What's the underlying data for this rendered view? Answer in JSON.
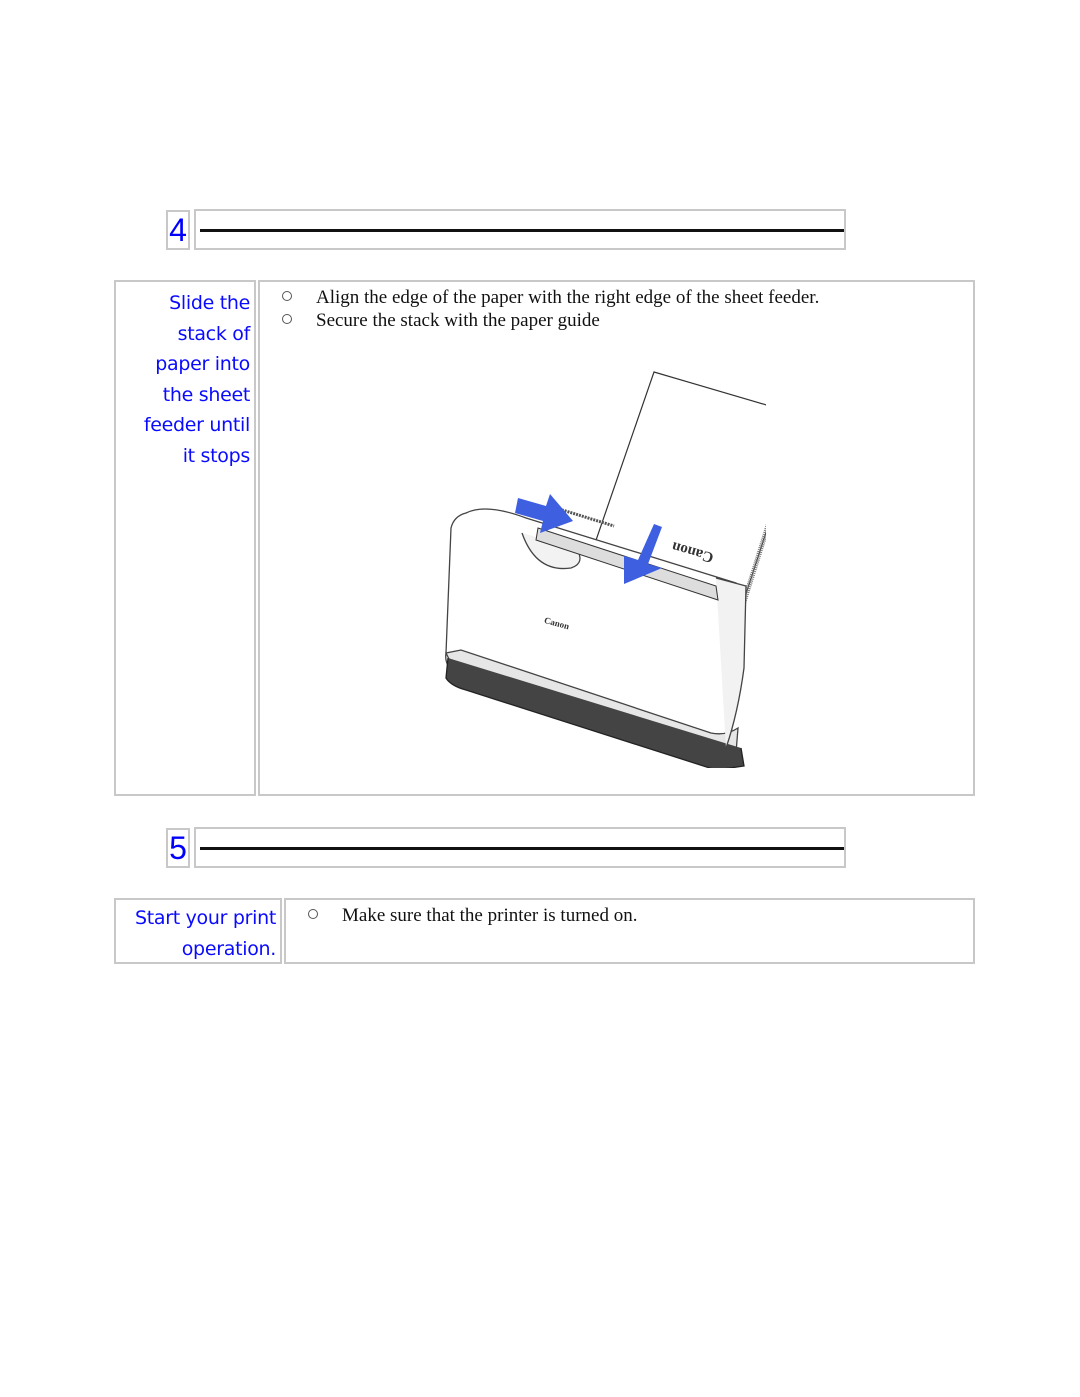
{
  "steps": [
    {
      "number": "4",
      "instruction": [
        "Slide the",
        "stack of",
        "paper into",
        "the sheet",
        "feeder until",
        "it stops"
      ],
      "bullets": [
        "Align the edge of the paper with the right edge of the sheet feeder.",
        "Secure the stack with the paper guide"
      ],
      "illustration": {
        "description": "Canon printer with paper stack loaded in sheet feeder; blue arrows indicate pushing paper guide and sliding paper down",
        "brand_label_front": "Canon",
        "brand_label_paper": "Canon",
        "arrow_color": "#3d5fe0"
      }
    },
    {
      "number": "5",
      "instruction": [
        "Start your print",
        "operation."
      ],
      "bullets": [
        "Make sure that the printer is turned on."
      ]
    }
  ],
  "colors": {
    "instruction_text": "#0a0aff",
    "step_number": "#0000ff",
    "border": "#c8c8c8"
  }
}
